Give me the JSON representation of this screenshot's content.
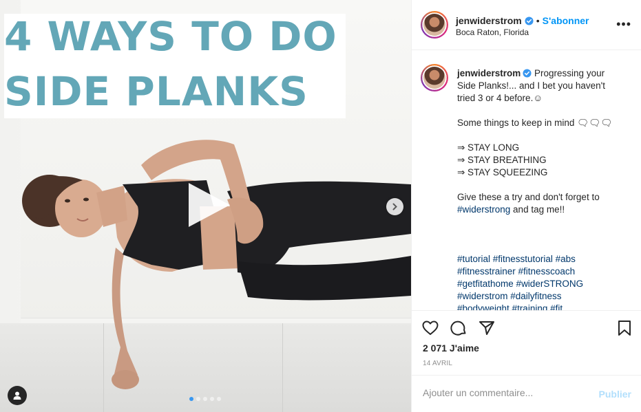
{
  "media": {
    "title_line1": "4 WAYS TO DO",
    "title_line2": "SIDE PLANKS",
    "play_icon": "play-icon",
    "next_icon": "chevron-right-icon",
    "tag_icon": "user-icon",
    "carousel_count": 5,
    "carousel_active": 0
  },
  "header": {
    "username": "jenwiderstrom",
    "separator": "•",
    "follow_label": "S'abonner",
    "location": "Boca Raton, Florida",
    "more_label": "•••"
  },
  "caption": {
    "username": "jenwiderstrom",
    "line1": " Progressing your Side Planks!... and I bet you haven't tried 3 or 4 before.☺",
    "line2": "Some things to keep in mind 🗨🗨🗨",
    "line3": "⇒ STAY LONG",
    "line4": "⇒ STAY BREATHING",
    "line5": "⇒ STAY SQUEEZING",
    "line6a": "Give these a try and don't forget to ",
    "line6_tag": "#widerstrong",
    "line6b": " and tag me!!",
    "hashtags": [
      "#tutorial #fitnesstutorial #abs",
      "#fitnesstrainer #fitnesscoach",
      "#getfitathome #widerSTRONG",
      "#widerstrom #dailyfitness",
      "#bodyweight #training #fit"
    ]
  },
  "actions": {
    "like_icon": "heart-icon",
    "comment_icon": "comment-icon",
    "share_icon": "share-icon",
    "save_icon": "bookmark-icon",
    "likes": "2 071 J'aime",
    "date": "14 AVRIL"
  },
  "comment": {
    "placeholder": "Ajouter un commentaire...",
    "publish_label": "Publier"
  },
  "colors": {
    "title": "#63a7b7",
    "follow": "#0095f6",
    "hashtag": "#00376b",
    "publish_disabled": "#b2dffc"
  }
}
